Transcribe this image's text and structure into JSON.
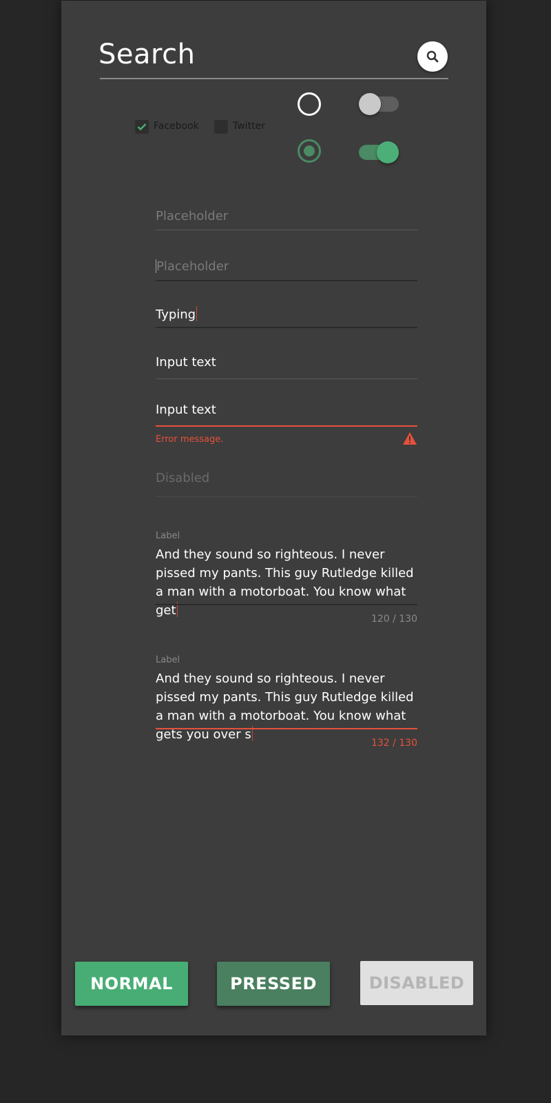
{
  "search": {
    "title": "Search",
    "icon": "search-icon"
  },
  "checkboxes": [
    {
      "label": "Facebook",
      "checked": true
    },
    {
      "label": "Twitter",
      "checked": false
    }
  ],
  "radios": [
    {
      "selected": false
    },
    {
      "selected": true
    }
  ],
  "toggles": [
    {
      "on": false
    },
    {
      "on": true
    }
  ],
  "inputs": {
    "placeholder_1": "Placeholder",
    "placeholder_2": "Placeholder",
    "typing": "Typing",
    "input_text": "Input text",
    "input_text_error": "Input text",
    "error_message": "Error message.",
    "disabled": "Disabled"
  },
  "textareas": [
    {
      "label": "Label",
      "value": "And they sound so righteous. I never pissed my pants. This guy Rutledge killed a man with a motorboat. You know what get",
      "counter": "120 / 130",
      "error": false
    },
    {
      "label": "Label",
      "value": "And they sound so righteous. I never pissed my pants. This guy Rutledge killed a man with a motorboat. You know what gets you over s",
      "counter": "132 / 130",
      "error": true
    }
  ],
  "buttons": {
    "normal": "NORMAL",
    "pressed": "PRESSED",
    "disabled": "DISABLED"
  },
  "colors": {
    "accent": "#47ad74",
    "error": "#e8503a",
    "panel": "#3d3d3d",
    "background": "#262626"
  }
}
